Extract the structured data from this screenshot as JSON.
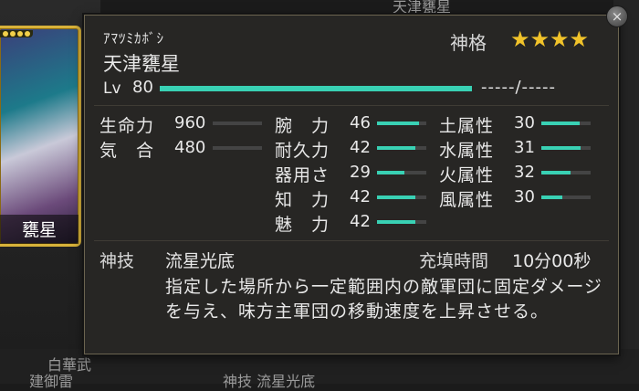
{
  "background": {
    "bottom_left_1": "白華武",
    "bottom_left_2": "建御雷",
    "bottom_mid": "神技 流星光底",
    "top_right": "天津甕星"
  },
  "card": {
    "name": "甕星",
    "rank_dots": 4
  },
  "tooltip": {
    "reading": "ｱﾏﾂﾐｶﾎﾞｼ",
    "name": "天津甕星",
    "rank_label": "神格",
    "stars": "★★★★",
    "star_count": 4,
    "level_label": "Lv",
    "level": "80",
    "exp_fraction": 1.0,
    "exp_text": "-----/-----",
    "close_icon": "×",
    "stats": [
      {
        "label": "生命力",
        "value": "960",
        "fill": 0.0
      },
      {
        "label": "気　合",
        "value": "480",
        "fill": 0.0
      },
      {
        "label": "腕　力",
        "value": "46",
        "fill": 0.85
      },
      {
        "label": "耐久力",
        "value": "42",
        "fill": 0.78
      },
      {
        "label": "器用さ",
        "value": "29",
        "fill": 0.55
      },
      {
        "label": "知　力",
        "value": "42",
        "fill": 0.78
      },
      {
        "label": "魅　力",
        "value": "42",
        "fill": 0.78
      },
      {
        "label": "土属性",
        "value": "30",
        "fill": 0.78
      },
      {
        "label": "水属性",
        "value": "31",
        "fill": 0.8
      },
      {
        "label": "火属性",
        "value": "32",
        "fill": 0.6
      },
      {
        "label": "風属性",
        "value": "30",
        "fill": 0.42
      }
    ],
    "skill": {
      "label": "神技",
      "name": "流星光底",
      "charge_label": "充填時間",
      "charge_value": "10分00秒",
      "description": "指定した場所から一定範囲内の敵軍団に固定ダメージを与え、味方主軍団の移動速度を上昇させる。"
    }
  }
}
